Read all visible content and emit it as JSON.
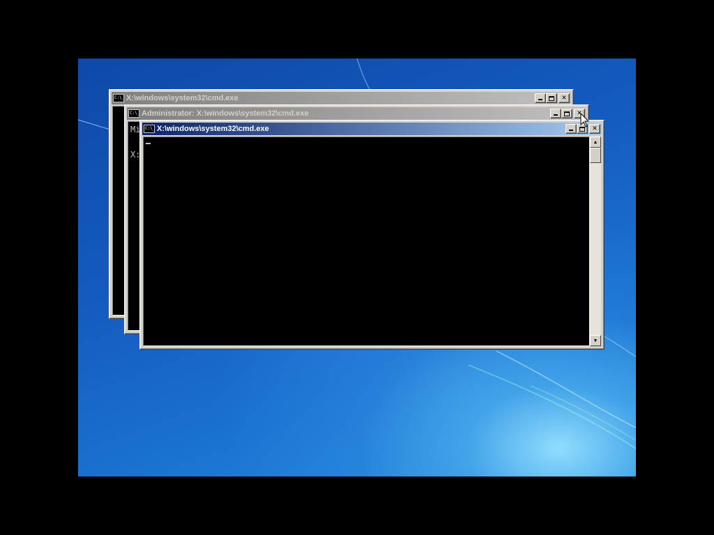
{
  "windows": [
    {
      "id": "back",
      "title": "X:\\windows\\system32\\cmd.exe",
      "active": false,
      "console_lines": []
    },
    {
      "id": "middle",
      "title": "Administrator: X:\\windows\\system32\\cmd.exe",
      "active": false,
      "console_lines": [
        "Mi",
        "",
        "X:"
      ]
    },
    {
      "id": "front",
      "title": "X:\\windows\\system32\\cmd.exe",
      "active": true,
      "console_cursor": "_"
    }
  ],
  "icons": {
    "window_icon": "cmd-icon",
    "window_icon_text": "C:\\_",
    "minimize": "minimize-icon",
    "maximize": "maximize-icon",
    "close": "close-icon",
    "scroll_up": "arrow-up-icon",
    "scroll_down": "arrow-down-icon",
    "pointer": "mouse-pointer-icon"
  },
  "glyphs": {
    "close": "✕",
    "up": "▲",
    "down": "▼"
  },
  "colors": {
    "desktop": "#1a6fd0",
    "active_title_start": "#0a246a",
    "active_title_end": "#a6caf0",
    "inactive_title_start": "#808080",
    "inactive_title_end": "#c0c0c0"
  }
}
